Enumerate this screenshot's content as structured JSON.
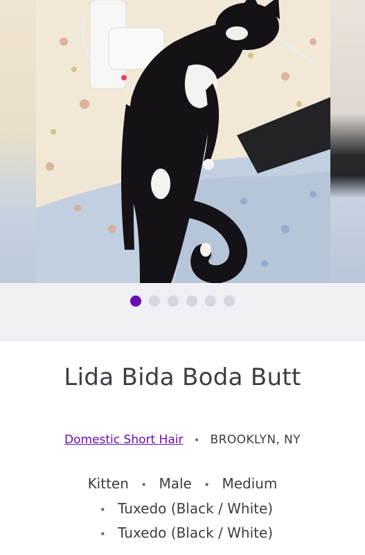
{
  "pet": {
    "name": "Lida Bida Boda Butt",
    "breed": "Domestic Short Hair",
    "location": "BROOKLYN, NY",
    "age": "Kitten",
    "sex": "Male",
    "size": "Medium",
    "colors": [
      "Tuxedo (Black / White)",
      "Tuxedo (Black / White)"
    ]
  },
  "carousel": {
    "total_photos": 6,
    "active_index": 0,
    "separator": "•"
  },
  "colors": {
    "accent": "#6a0dad",
    "dot_inactive": "#d6d4dc",
    "text": "#3d3a44"
  }
}
